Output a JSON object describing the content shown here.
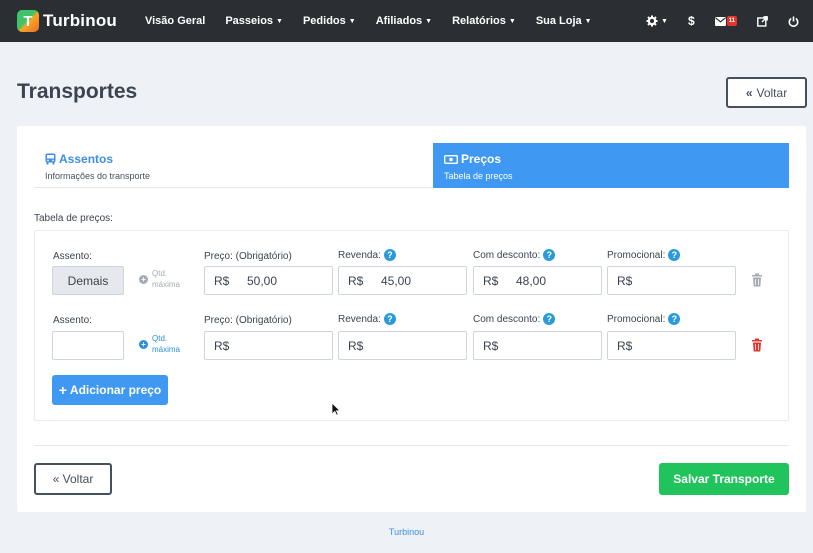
{
  "navbar": {
    "brand_letter": "T",
    "brand_name": "Turbinou",
    "items": [
      {
        "label": "Visão Geral",
        "dropdown": false
      },
      {
        "label": "Passeios",
        "dropdown": true
      },
      {
        "label": "Pedidos",
        "dropdown": true
      },
      {
        "label": "Afiliados",
        "dropdown": true
      },
      {
        "label": "Relatórios",
        "dropdown": true
      },
      {
        "label": "Sua Loja",
        "dropdown": true
      }
    ],
    "icons": [
      "gear-icon",
      "dollar-icon",
      "envelope-icon",
      "external-link-icon",
      "power-icon"
    ],
    "dollar_symbol": "$",
    "mail_badge": "11"
  },
  "page": {
    "title": "Transportes",
    "back_top_label": "Voltar"
  },
  "wizard": {
    "steps": [
      {
        "title": "Assentos",
        "subtitle": "Informações do transporte",
        "icon": "bus-icon",
        "active": false
      },
      {
        "title": "Preços",
        "subtitle": "Tabela de preços",
        "icon": "money-icon",
        "active": true
      }
    ]
  },
  "price_table": {
    "section_label": "Tabela de preços:",
    "labels": {
      "seat": "Assento:",
      "price": "Preço: (Obrigatório)",
      "resale": "Revenda:",
      "discount": "Com desconto:",
      "promo": "Promocional:"
    },
    "qtd_label_1": "Qtd.",
    "qtd_label_2": "máxima",
    "currency": "R$",
    "rows": [
      {
        "seat": "Demais",
        "price": "50,00",
        "resale": "45,00",
        "discount": "48,00",
        "promo": "",
        "qtd_enabled": false,
        "delete_enabled": false
      },
      {
        "seat": "",
        "price": "",
        "resale": "",
        "discount": "",
        "promo": "",
        "qtd_enabled": true,
        "delete_enabled": true
      }
    ],
    "add_button": "Adicionar preço"
  },
  "actions": {
    "back_label": "« Voltar",
    "save_label": "Salvar Transporte"
  },
  "footer": {
    "text": "Turbinou"
  },
  "colors": {
    "navbar": "#2b2f33",
    "accent_blue": "#3f98f2",
    "save_green": "#21c45c",
    "danger_red": "#e3342f"
  }
}
